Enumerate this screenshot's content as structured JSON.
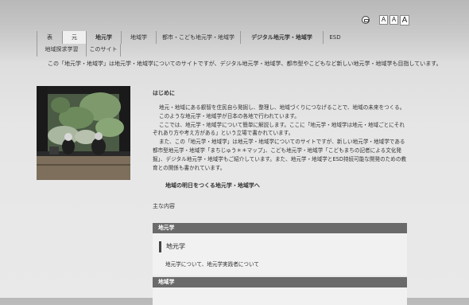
{
  "font_size_labels": [
    "A",
    "A",
    "A"
  ],
  "nav": {
    "row1": [
      "表",
      "元",
      "地元学",
      "地域学",
      "都市・こども地元学・地域学",
      "デジタル地元学・地域学",
      "ESD"
    ],
    "row2": [
      "地域探求学習",
      "このサイト"
    ]
  },
  "intro": "この「地元学・地域学」は地元学・地域学についてのサイトですが、デジタル地元学・地域学、都市型やこどもなど新しい地元学・地域学も目指しています。",
  "section": {
    "heading": "はじめに",
    "p1": "地元・地域にある叡智を住民自ら発掘し、整理し、地域づくりにつなげることで、地域の未来をつくる。",
    "p2": "このような地元学・地域学が日本の各地で行われています。",
    "p3": "ここでは、地元学・地域学について簡単に解説します。ここに「地元学・地域学は地元・地域ごとにそれぞれあり方や考え方がある」という立場で書かれています。",
    "p4": "また、この「地元学・地域学」は地元学・地域学についてのサイトですが、新しい地元学・地域学である都市型地元学・地域学「まちじゅう＊＊マップ」、こども地元学・地域学「こどもまちの記者による文化発掘」、デジタル地元学・地域学もご紹介しています。また、地元学・地域学とESD持続可能な開発のための教育との関係も書かれています。",
    "cta": "地域の明日をつくる地元学・地域学へ",
    "main_label": "主な内容"
  },
  "blocks": [
    {
      "head": "地元学",
      "title": "地元学",
      "desc": "地元学について、地元学実践者について"
    },
    {
      "head": "地域学",
      "title": "",
      "desc": ""
    }
  ],
  "colors": {
    "block_head": "#6a6a6a",
    "active_tab": "#efefef"
  }
}
